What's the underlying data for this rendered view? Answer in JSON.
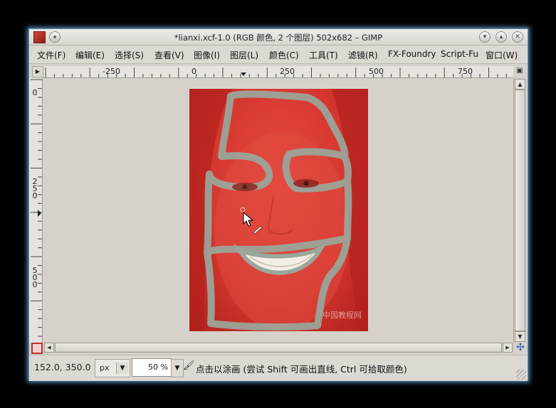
{
  "window": {
    "title": "*lianxi.xcf-1.0 (RGB 颜色, 2 个图层) 502x682 – GIMP",
    "app_icon": "gimp-image-thumbnail-icon",
    "menu_button_icon": "window-menu-icon",
    "controls": [
      "minimize-icon",
      "maximize-icon",
      "close-icon"
    ]
  },
  "menubar": {
    "items": [
      {
        "label": "文件(F)"
      },
      {
        "label": "编辑(E)"
      },
      {
        "label": "选择(S)"
      },
      {
        "label": "查看(V)"
      },
      {
        "label": "图像(I)"
      },
      {
        "label": "图层(L)"
      },
      {
        "label": "颜色(C)"
      },
      {
        "label": "工具(T)"
      },
      {
        "label": "滤镜(R)"
      },
      {
        "label": "FX-Foundry"
      },
      {
        "label": "Script-Fu"
      },
      {
        "label": "窗口(W)"
      }
    ]
  },
  "rulers": {
    "horizontal_labels": [
      "-250",
      "0",
      "250",
      "500",
      "750"
    ],
    "vertical_labels": [
      "0",
      "250",
      "500"
    ]
  },
  "canvas": {
    "mask_color": "#d9362d",
    "stroke_color": "#9aa79c",
    "watermark": "中国教程网"
  },
  "statusbar": {
    "pointer_coords": "152.0, 350.0",
    "unit": "px",
    "zoom": "50 %",
    "tool_icon": "paintbrush-icon",
    "message": "点击以涂画 (尝试 Shift 可画出直线, Ctrl 可拾取颜色)"
  }
}
